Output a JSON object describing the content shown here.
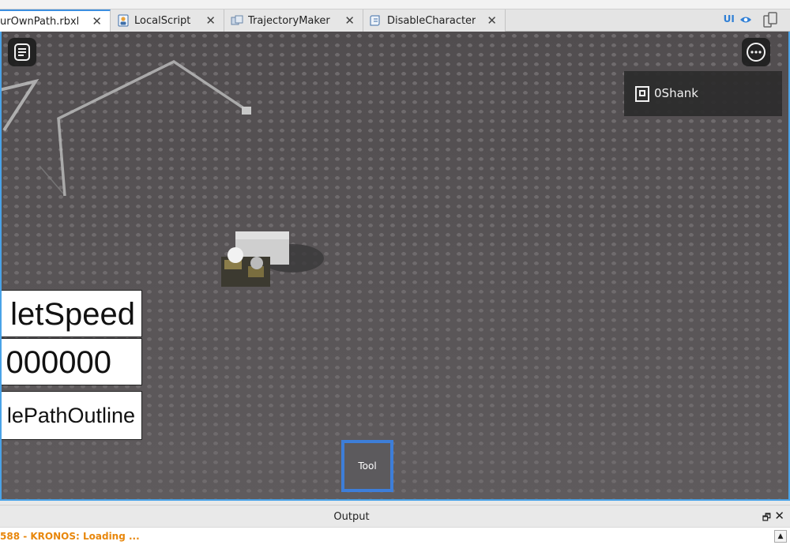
{
  "tabs": [
    {
      "label": "urOwnPath.rbxl",
      "close": "✕",
      "icon": "place-file-icon",
      "active": true
    },
    {
      "label": "LocalScript",
      "close": "✕",
      "icon": "local-script-icon",
      "active": false
    },
    {
      "label": "TrajectoryMaker",
      "close": "✕",
      "icon": "module-script-icon",
      "active": false
    },
    {
      "label": "DisableCharacter",
      "close": "✕",
      "icon": "script-icon",
      "active": false
    }
  ],
  "toolbar": {
    "ui_toggle": "UI",
    "ui_toggle_icon": "eye-icon",
    "device_icon": "device-emulator-icon"
  },
  "viewport": {
    "player_list": {
      "player_name": "0Shank",
      "icon": "roblox-logo-icon"
    },
    "gui": {
      "speed_label": "letSpeed",
      "speed_value": "000000",
      "outline_label": "lePathOutline"
    },
    "toolbar_slot": {
      "label": "Tool"
    },
    "colors": {
      "accent": "#3d7ed9",
      "selection": "#4aa3e8"
    }
  },
  "output": {
    "title": "Output",
    "dock": "🗗",
    "close": "✕",
    "line": "588 - KRONOS: Loading ...",
    "line_color": "#e8870c",
    "scroll_up": "▲"
  }
}
